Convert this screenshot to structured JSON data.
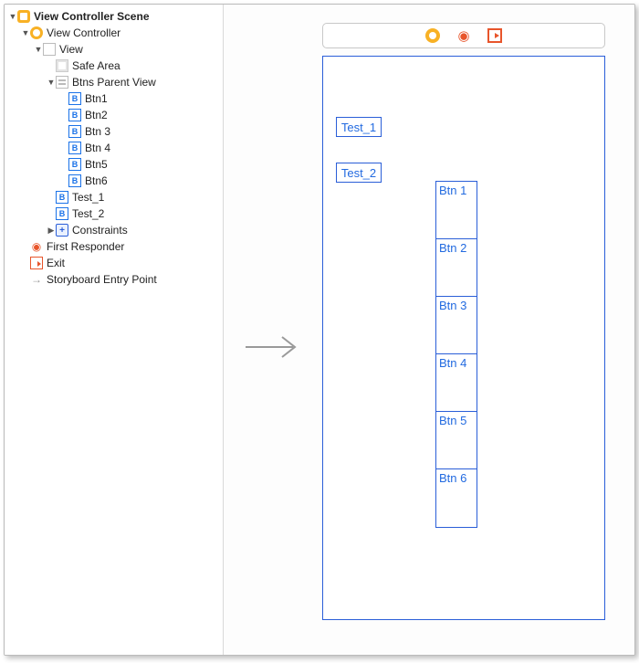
{
  "outline": {
    "scene": "View Controller Scene",
    "vc": "View Controller",
    "view": "View",
    "safeArea": "Safe Area",
    "parentView": "Btns Parent View",
    "btns": [
      "Btn1",
      "Btn2",
      "Btn 3",
      "Btn 4",
      "Btn5",
      "Btn6"
    ],
    "tests": [
      "Test_1",
      "Test_2"
    ],
    "constraints": "Constraints",
    "firstResponder": "First Responder",
    "exit": "Exit",
    "entryPoint": "Storyboard Entry Point"
  },
  "canvas": {
    "test1": "Test_1",
    "test2": "Test_2",
    "stackButtons": [
      "Btn 1",
      "Btn 2",
      "Btn 3",
      "Btn 4",
      "Btn 5",
      "Btn 6"
    ]
  },
  "icons": {
    "btnGlyph": "B"
  }
}
